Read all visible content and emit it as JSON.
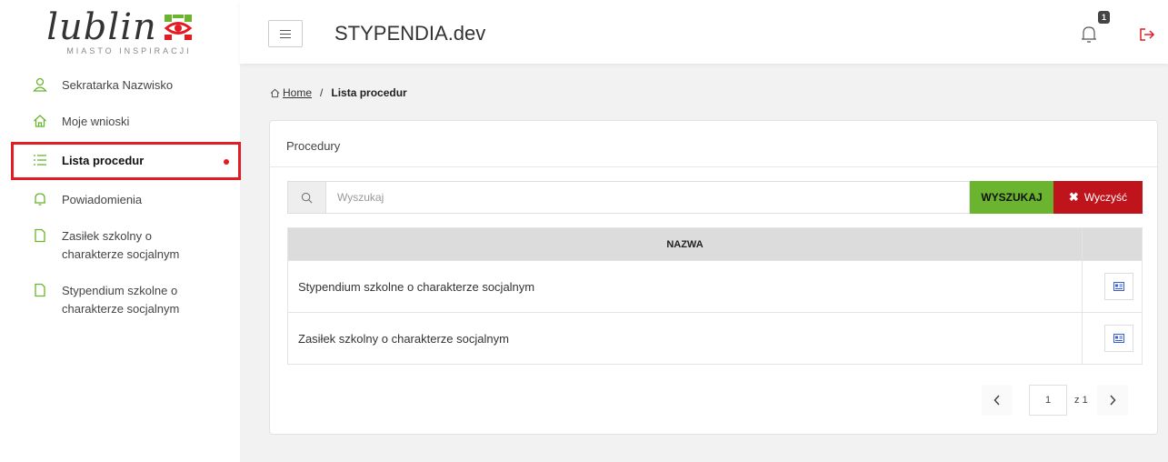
{
  "logo": {
    "name": "lublin",
    "tagline": "MIASTO INSPIRACJI"
  },
  "header": {
    "title": "STYPENDIA.dev",
    "notification_count": "1"
  },
  "sidebar": {
    "items": [
      {
        "label": "Sekratarka Nazwisko",
        "icon": "user-icon"
      },
      {
        "label": "Moje wnioski",
        "icon": "home-icon"
      },
      {
        "label": "Lista procedur",
        "icon": "list-icon",
        "active": true
      },
      {
        "label": "Powiadomienia",
        "icon": "bell-icon"
      },
      {
        "label": "Zasiłek szkolny o charakterze socjalnym",
        "icon": "file-icon"
      },
      {
        "label": "Stypendium szkolne o charakterze socjalnym",
        "icon": "file-icon"
      }
    ]
  },
  "breadcrumb": {
    "home": "Home",
    "separator": "/",
    "current": "Lista procedur"
  },
  "card": {
    "title": "Procedury",
    "search": {
      "placeholder": "Wyszukaj",
      "value": ""
    },
    "search_button": "WYSZUKAJ",
    "clear_button": "Wyczyść",
    "clear_icon": "✖",
    "table": {
      "headers": [
        "NAZWA",
        ""
      ],
      "rows": [
        {
          "name": "Stypendium szkolne o charakterze socjalnym"
        },
        {
          "name": "Zasiłek szkolny o charakterze socjalnym"
        }
      ]
    },
    "pagination": {
      "current": "1",
      "of_label": "z",
      "total": "1"
    }
  },
  "colors": {
    "accent_red": "#e31b23",
    "search_green": "#6ab42f",
    "clear_red": "#c0141c"
  }
}
